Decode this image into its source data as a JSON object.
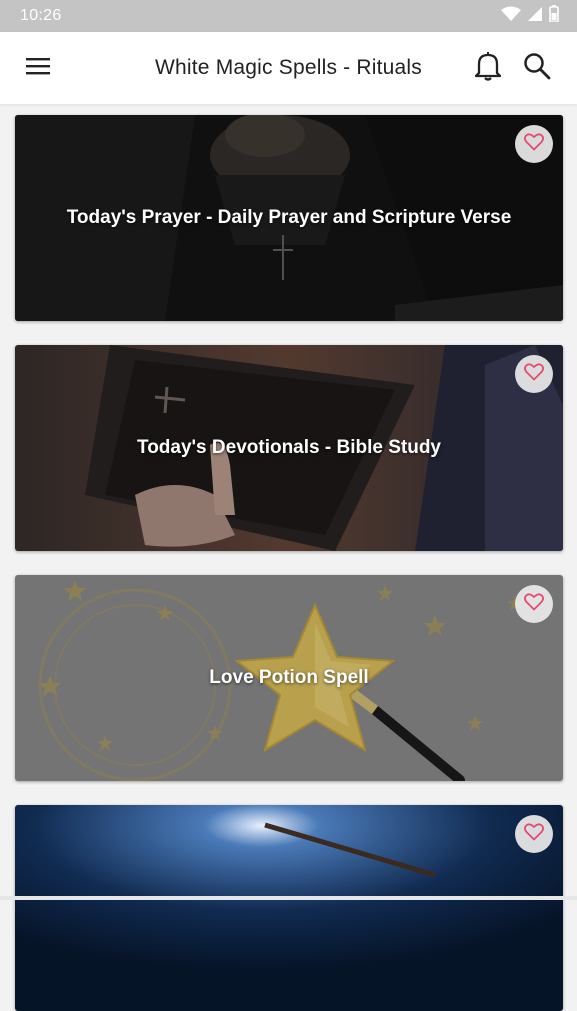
{
  "status_bar": {
    "time": "10:26",
    "icons": [
      "wifi-icon",
      "signal-icon",
      "battery-icon"
    ]
  },
  "app_bar": {
    "title": "White Magic Spells - Rituals",
    "icons": [
      "menu-icon",
      "bell-icon",
      "search-icon"
    ]
  },
  "cards": [
    {
      "title": "Today's Prayer - Daily Prayer and Scripture Verse",
      "favorite_icon": "heart-outline-icon"
    },
    {
      "title": "Today's Devotionals - Bible Study",
      "favorite_icon": "heart-outline-icon"
    },
    {
      "title": "Love Potion Spell",
      "favorite_icon": "heart-outline-icon"
    },
    {
      "title": "",
      "favorite_icon": "heart-outline-icon"
    }
  ],
  "colors": {
    "status_bar": "#c4c4c4",
    "app_bar": "#ffffff",
    "background": "#f2f2f2",
    "heart": "#e64a6e"
  }
}
